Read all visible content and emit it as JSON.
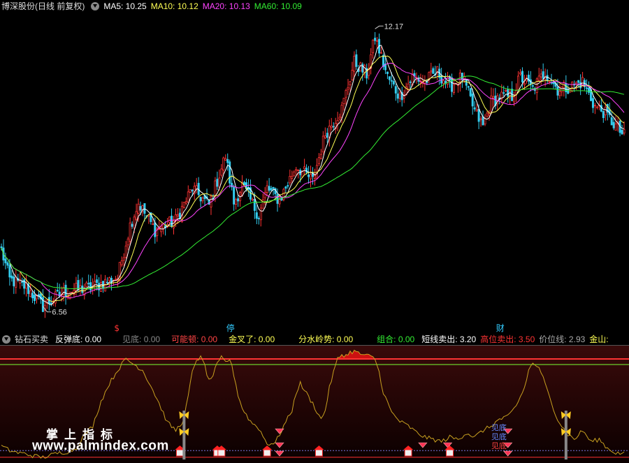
{
  "header": {
    "title": "博深股份(日线 前复权)",
    "ma": [
      {
        "label": "MA5: 10.25",
        "color": "#ffffff"
      },
      {
        "label": "MA10: 10.12",
        "color": "#ffff55"
      },
      {
        "label": "MA20: 10.13",
        "color": "#ff44ff"
      },
      {
        "label": "MA60: 10.09",
        "color": "#33ee33"
      }
    ]
  },
  "indicator": {
    "title": "钻石买卖",
    "items": [
      {
        "label": "反弹底: 0.00",
        "color": "#ffffff"
      },
      {
        "label": "见底: 0.00",
        "color": "#888888"
      },
      {
        "label": "可能顿: 0.00",
        "color": "#ff4444"
      },
      {
        "label": "金叉了: 0.00",
        "color": "#ffff55"
      },
      {
        "label": "分水岭势: 0.00",
        "color": "#ffff55"
      },
      {
        "label": "组合: 0.00",
        "color": "#33ee33"
      },
      {
        "label": "短线卖出: 3.20",
        "color": "#ffffff"
      },
      {
        "label": "高位卖出: 3.50",
        "color": "#ff3333"
      },
      {
        "label": "价位线: 2.93",
        "color": "#aaaaaa"
      },
      {
        "label": "金山:",
        "color": "#ffff55"
      }
    ]
  },
  "markers": [
    {
      "text": "$",
      "color": "#ff3333",
      "x_index": 56
    },
    {
      "text": "停",
      "color": "#33ccff",
      "x_index": 110
    },
    {
      "text": "财",
      "color": "#33ccff",
      "x_index": 240
    }
  ],
  "signal_texts": [
    "见底",
    "见底",
    "见底"
  ],
  "watermark": {
    "cn": "掌上指标",
    "url": "www.palmindex.com"
  },
  "colors": {
    "up": "#ff3333",
    "down": "#33ccee",
    "ma5": "#ffffff",
    "ma10": "#ffff55",
    "ma20": "#ff44ff",
    "ma60": "#33ee33"
  },
  "chart_data": {
    "type": "candlestick",
    "y_range": [
      6.3,
      12.4
    ],
    "annotations": [
      {
        "text": "12.17",
        "index": 180,
        "value": 12.17
      },
      {
        "text": "6.56",
        "index": 20,
        "value": 6.56
      }
    ],
    "anchors": [
      [
        0,
        7.7
      ],
      [
        4,
        7.1
      ],
      [
        12,
        6.95
      ],
      [
        20,
        6.56
      ],
      [
        30,
        6.85
      ],
      [
        44,
        6.95
      ],
      [
        56,
        7.15
      ],
      [
        62,
        8.2
      ],
      [
        66,
        8.65
      ],
      [
        74,
        8.1
      ],
      [
        84,
        8.3
      ],
      [
        92,
        8.95
      ],
      [
        100,
        8.6
      ],
      [
        108,
        9.6
      ],
      [
        112,
        8.65
      ],
      [
        116,
        9.0
      ],
      [
        124,
        8.4
      ],
      [
        128,
        8.95
      ],
      [
        134,
        8.7
      ],
      [
        142,
        9.4
      ],
      [
        150,
        9.1
      ],
      [
        156,
        10.05
      ],
      [
        164,
        10.55
      ],
      [
        170,
        11.5
      ],
      [
        176,
        11.25
      ],
      [
        180,
        12.0
      ],
      [
        186,
        11.2
      ],
      [
        192,
        10.8
      ],
      [
        198,
        11.2
      ],
      [
        204,
        11.1
      ],
      [
        210,
        11.3
      ],
      [
        216,
        11.0
      ],
      [
        222,
        11.2
      ],
      [
        228,
        10.5
      ],
      [
        232,
        10.2
      ],
      [
        236,
        10.7
      ],
      [
        240,
        10.8
      ],
      [
        246,
        10.8
      ],
      [
        250,
        11.2
      ],
      [
        256,
        10.95
      ],
      [
        262,
        11.3
      ],
      [
        268,
        10.95
      ],
      [
        274,
        11.0
      ],
      [
        280,
        11.1
      ],
      [
        286,
        10.6
      ],
      [
        290,
        10.5
      ],
      [
        296,
        10.2
      ],
      [
        300,
        10.0
      ]
    ],
    "oscillator": {
      "y_range": [
        0,
        100
      ],
      "thresholds": [
        {
          "value": 90,
          "color": "#ff3333"
        },
        {
          "value": 85,
          "color": "#77ff33"
        },
        {
          "value": 2,
          "color": "#ff3333"
        }
      ],
      "anchors": [
        [
          0,
          12
        ],
        [
          4,
          8
        ],
        [
          8,
          6
        ],
        [
          12,
          5
        ],
        [
          16,
          3
        ],
        [
          20,
          2
        ],
        [
          24,
          4
        ],
        [
          28,
          6
        ],
        [
          32,
          7
        ],
        [
          36,
          10
        ],
        [
          40,
          22
        ],
        [
          44,
          30
        ],
        [
          48,
          52
        ],
        [
          52,
          68
        ],
        [
          56,
          80
        ],
        [
          60,
          90
        ],
        [
          64,
          85
        ],
        [
          68,
          80
        ],
        [
          72,
          66
        ],
        [
          76,
          50
        ],
        [
          80,
          33
        ],
        [
          84,
          26
        ],
        [
          88,
          36
        ],
        [
          92,
          78
        ],
        [
          94,
          90
        ],
        [
          96,
          91
        ],
        [
          98,
          84
        ],
        [
          100,
          70
        ],
        [
          102,
          76
        ],
        [
          104,
          85
        ],
        [
          106,
          91
        ],
        [
          108,
          87
        ],
        [
          110,
          90
        ],
        [
          112,
          76
        ],
        [
          114,
          58
        ],
        [
          116,
          46
        ],
        [
          120,
          34
        ],
        [
          124,
          28
        ],
        [
          128,
          14
        ],
        [
          132,
          15
        ],
        [
          136,
          30
        ],
        [
          140,
          44
        ],
        [
          142,
          60
        ],
        [
          144,
          68
        ],
        [
          146,
          62
        ],
        [
          150,
          50
        ],
        [
          154,
          36
        ],
        [
          156,
          44
        ],
        [
          158,
          64
        ],
        [
          160,
          78
        ],
        [
          162,
          90
        ],
        [
          164,
          94
        ],
        [
          166,
          93
        ],
        [
          168,
          96
        ],
        [
          170,
          97
        ],
        [
          172,
          95
        ],
        [
          174,
          94
        ],
        [
          176,
          93
        ],
        [
          178,
          92
        ],
        [
          180,
          90
        ],
        [
          182,
          78
        ],
        [
          184,
          60
        ],
        [
          188,
          42
        ],
        [
          192,
          34
        ],
        [
          196,
          30
        ],
        [
          200,
          24
        ],
        [
          204,
          20
        ],
        [
          208,
          18
        ],
        [
          212,
          16
        ],
        [
          216,
          20
        ],
        [
          220,
          18
        ],
        [
          224,
          24
        ],
        [
          228,
          20
        ],
        [
          232,
          26
        ],
        [
          236,
          30
        ],
        [
          240,
          36
        ],
        [
          244,
          38
        ],
        [
          248,
          48
        ],
        [
          252,
          64
        ],
        [
          254,
          80
        ],
        [
          256,
          86
        ],
        [
          258,
          84
        ],
        [
          260,
          78
        ],
        [
          264,
          56
        ],
        [
          268,
          36
        ],
        [
          272,
          24
        ],
        [
          276,
          18
        ],
        [
          280,
          26
        ],
        [
          284,
          16
        ],
        [
          288,
          18
        ],
        [
          292,
          10
        ],
        [
          296,
          6
        ],
        [
          300,
          5
        ]
      ]
    }
  }
}
